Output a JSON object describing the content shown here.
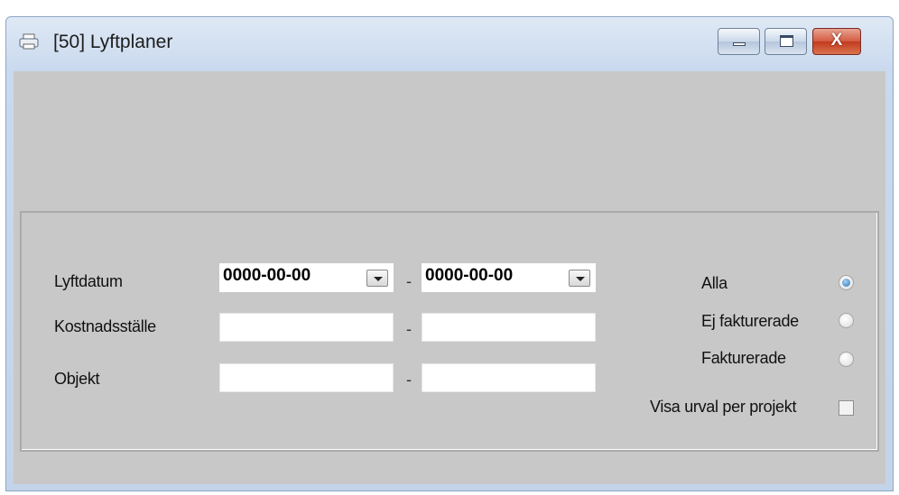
{
  "window": {
    "title": "[50]  Lyftplaner",
    "icon": "printer-icon",
    "controls": {
      "minimize": "minimize-icon",
      "maximize": "maximize-icon",
      "close_glyph": "X"
    }
  },
  "filters": {
    "lyftdatum": {
      "label": "Lyftdatum",
      "from": "0000-00-00",
      "to": "0000-00-00",
      "separator": "-"
    },
    "kostnadsstalle": {
      "label": "Kostnadsställe",
      "from": "",
      "to": "",
      "separator": "-"
    },
    "objekt": {
      "label": "Objekt",
      "from": "",
      "to": "",
      "separator": "-"
    }
  },
  "status": {
    "options": [
      {
        "label": "Alla",
        "selected": true
      },
      {
        "label": "Ej fakturerade",
        "selected": false
      },
      {
        "label": "Fakturerade",
        "selected": false
      }
    ],
    "per_project": {
      "label": "Visa urval per projekt",
      "checked": false
    }
  },
  "colors": {
    "panel": "#c8c8c8",
    "selected_radio": "#2a73b8",
    "close_button": "#c23a1f"
  }
}
